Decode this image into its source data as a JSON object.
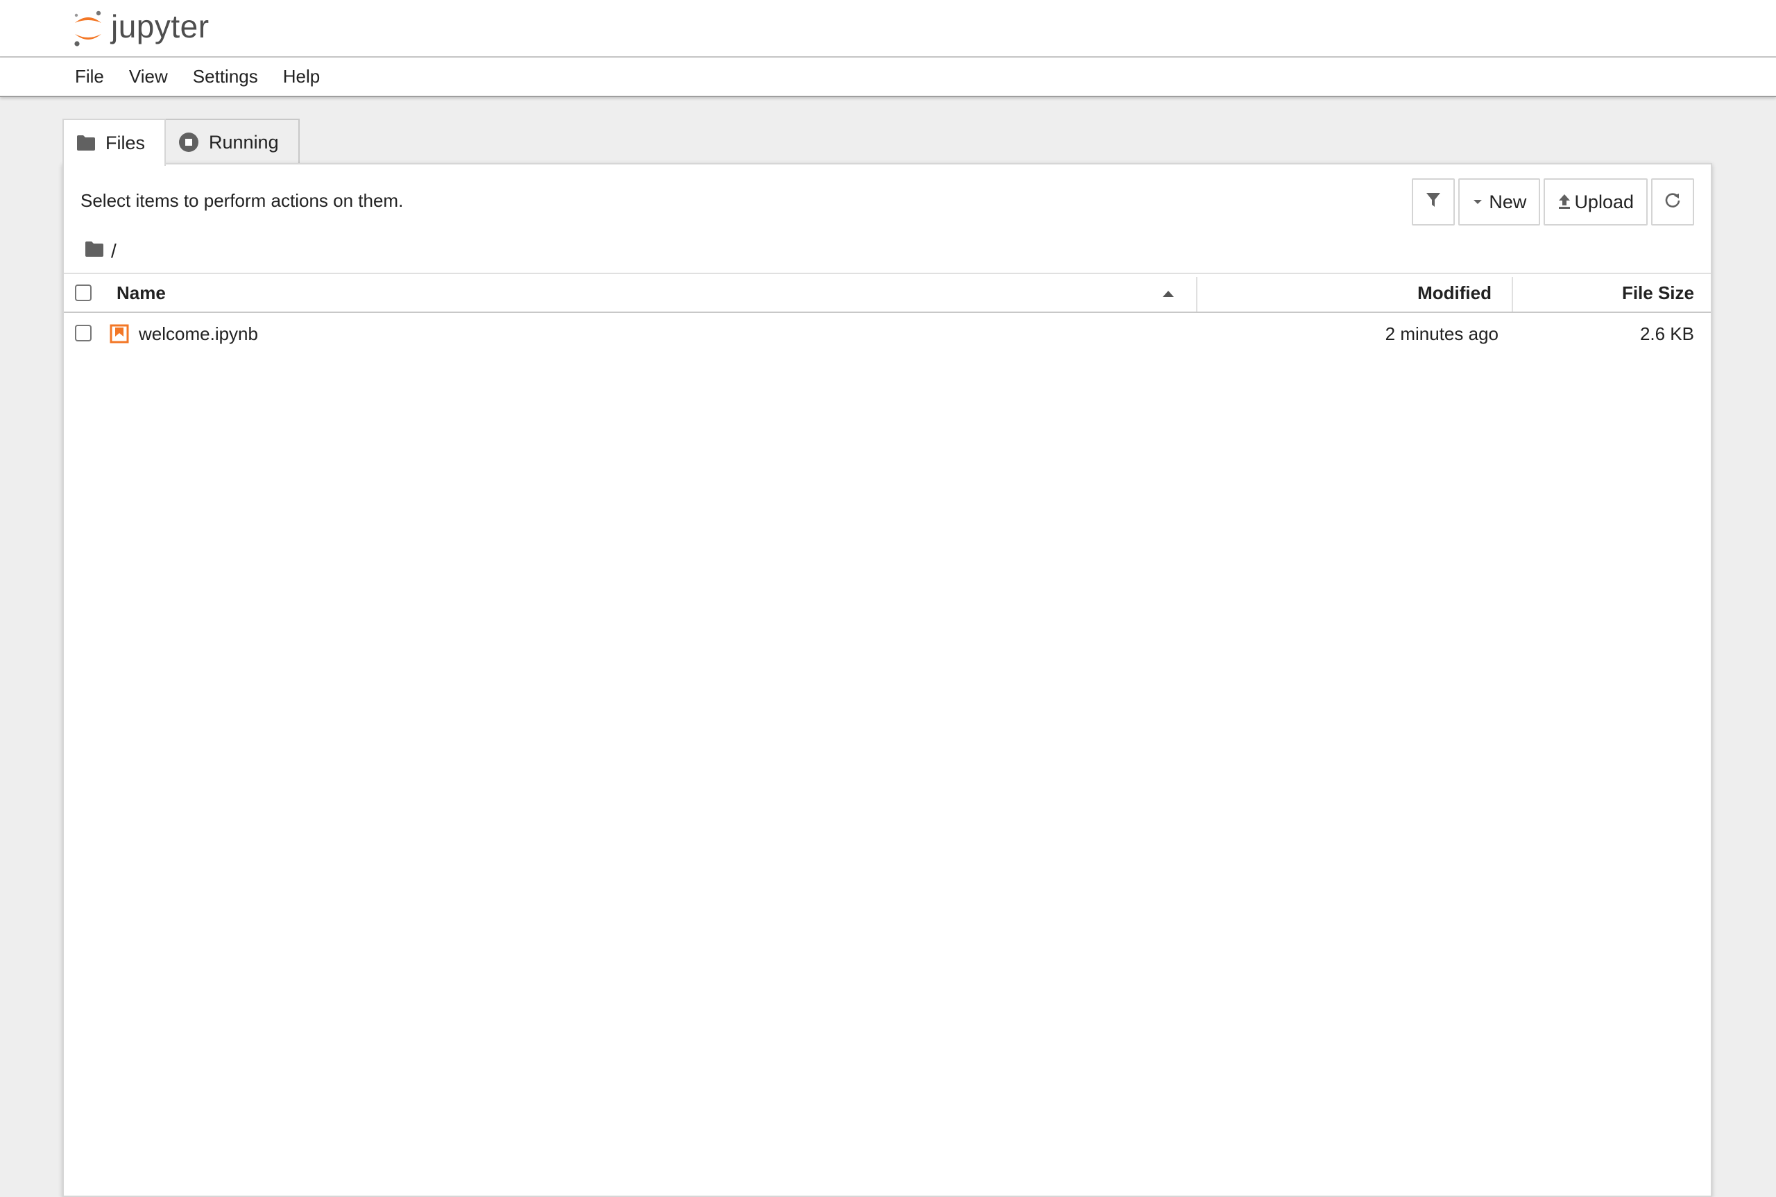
{
  "app": {
    "logo_text": "jupyter",
    "brand_color": "#F37726"
  },
  "menu": {
    "items": [
      {
        "label": "File"
      },
      {
        "label": "View"
      },
      {
        "label": "Settings"
      },
      {
        "label": "Help"
      }
    ]
  },
  "tabs": [
    {
      "label": "Files",
      "icon": "folder-icon",
      "active": true
    },
    {
      "label": "Running",
      "icon": "stop-circle-icon",
      "active": false
    }
  ],
  "panel": {
    "hint": "Select items to perform actions on them.",
    "toolbar": {
      "filter_icon": "filter-icon",
      "new_label": "New",
      "upload_label": "Upload",
      "refresh_icon": "refresh-icon"
    },
    "breadcrumb": {
      "root_icon": "folder-icon",
      "path": "/"
    }
  },
  "table": {
    "columns": {
      "name": "Name",
      "modified": "Modified",
      "file_size": "File Size"
    },
    "sort": {
      "column": "Name",
      "direction": "ascending"
    },
    "rows": [
      {
        "name": "welcome.ipynb",
        "icon": "notebook-icon",
        "modified": "2 minutes ago",
        "size": "2.6 KB",
        "checked": false
      }
    ]
  }
}
